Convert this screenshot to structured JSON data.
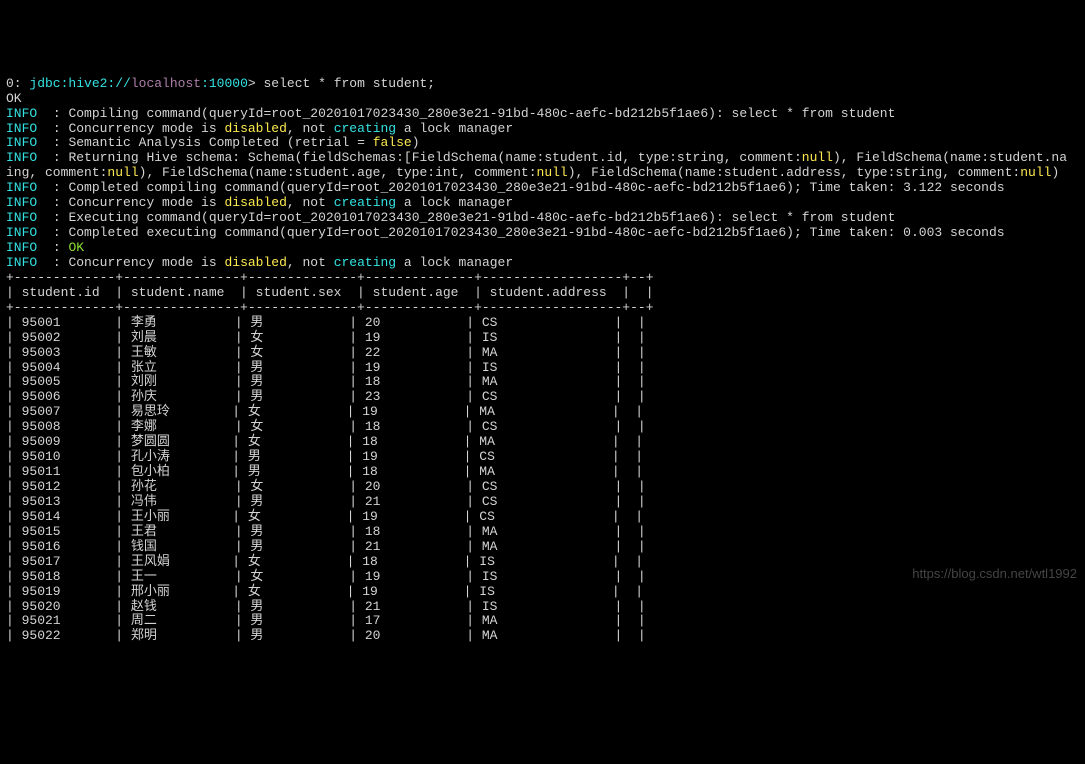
{
  "prompt": {
    "prefix": "0: ",
    "scheme": "jdbc:",
    "proto": "hive2://",
    "host": "localhost",
    "port": ":10000",
    "caret": "> ",
    "sql": "select * from student;"
  },
  "ok": "OK",
  "log": {
    "info_label": "INFO",
    "sep": "  : ",
    "l1_a": "Compiling command(queryId=root_20201017023430_280e3e21-91bd-480c-aefc-bd212b5f1ae6): select * from student",
    "l2_a": "Concurrency mode is ",
    "l2_b": "disabled",
    "l2_c": ", not ",
    "l2_d": "creating",
    "l2_e": " a lock manager",
    "l3_a": "Semantic Analysis Completed (retrial = ",
    "l3_b": "false",
    "l3_c": ")",
    "l4_a": "Returning Hive schema: Schema(fieldSchemas:[FieldSchema(name:student.id, type:string, comment:",
    "l4_b": "null",
    "l4_c": "), FieldSchema(name:student.na",
    "l4w_a": "ing, comment:",
    "l4w_b": "null",
    "l4w_c": "), FieldSchema(name:student.age, type:int, comment:",
    "l4w_d": "null",
    "l4w_e": "), FieldSchema(name:student.address, type:string, comment:",
    "l4w_f": "null",
    "l4w_g": ")",
    "l5_a": "Completed compiling command(queryId=root_20201017023430_280e3e21-91bd-480c-aefc-bd212b5f1ae6); Time taken: 3.122 seconds",
    "l6_a": "Executing command(queryId=root_20201017023430_280e3e21-91bd-480c-aefc-bd212b5f1ae6): select * from student",
    "l7_a": "Completed executing command(queryId=root_20201017023430_280e3e21-91bd-480c-aefc-bd212b5f1ae6); Time taken: 0.003 seconds",
    "l8_ok": "OK"
  },
  "table": {
    "border": "+-------------+---------------+--------------+--------------+------------------+--+",
    "header": "| student.id  | student.name  | student.sex  | student.age  | student.address  |  |",
    "rows": [
      "| 95001       | 李勇          | 男           | 20           | CS               |  |",
      "| 95002       | 刘晨          | 女           | 19           | IS               |  |",
      "| 95003       | 王敏          | 女           | 22           | MA               |  |",
      "| 95004       | 张立          | 男           | 19           | IS               |  |",
      "| 95005       | 刘刚          | 男           | 18           | MA               |  |",
      "| 95006       | 孙庆          | 男           | 23           | CS               |  |",
      "| 95007       | 易思玲        | 女           | 19           | MA               |  |",
      "| 95008       | 李娜          | 女           | 18           | CS               |  |",
      "| 95009       | 梦圆圆        | 女           | 18           | MA               |  |",
      "| 95010       | 孔小涛        | 男           | 19           | CS               |  |",
      "| 95011       | 包小柏        | 男           | 18           | MA               |  |",
      "| 95012       | 孙花          | 女           | 20           | CS               |  |",
      "| 95013       | 冯伟          | 男           | 21           | CS               |  |",
      "| 95014       | 王小丽        | 女           | 19           | CS               |  |",
      "| 95015       | 王君          | 男           | 18           | MA               |  |",
      "| 95016       | 钱国          | 男           | 21           | MA               |  |",
      "| 95017       | 王风娟        | 女           | 18           | IS               |  |",
      "| 95018       | 王一          | 女           | 19           | IS               |  |",
      "| 95019       | 邢小丽        | 女           | 19           | IS               |  |",
      "| 95020       | 赵钱          | 男           | 21           | IS               |  |",
      "| 95021       | 周二          | 男           | 17           | MA               |  |",
      "| 95022       | 郑明          | 男           | 20           | MA               |  |"
    ]
  },
  "watermark": "https://blog.csdn.net/wtl1992"
}
